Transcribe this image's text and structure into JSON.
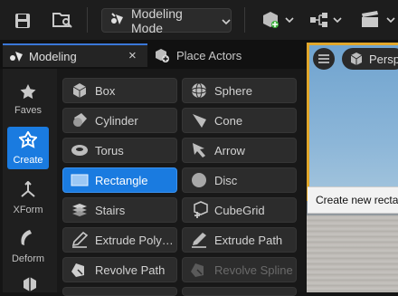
{
  "toolbar": {
    "mode_label": "Modeling Mode",
    "icons": [
      "save-icon",
      "content-browser-icon",
      "mode-icon",
      "add-actor-icon",
      "blueprint-icon",
      "cinematics-icon"
    ]
  },
  "tabs": [
    {
      "label": "Modeling",
      "active": true,
      "close": "×"
    },
    {
      "label": "Place Actors",
      "active": false
    }
  ],
  "rail": [
    {
      "label": "Faves",
      "icon": "star-icon",
      "active": false
    },
    {
      "label": "Create",
      "icon": "create-icon",
      "active": true
    },
    {
      "label": "XForm",
      "icon": "xform-icon",
      "active": false
    },
    {
      "label": "Deform",
      "icon": "deform-icon",
      "active": false
    }
  ],
  "tools": [
    {
      "label": "Box",
      "icon": "box-icon"
    },
    {
      "label": "Sphere",
      "icon": "sphere-icon"
    },
    {
      "label": "Cylinder",
      "icon": "cylinder-icon"
    },
    {
      "label": "Cone",
      "icon": "cone-icon"
    },
    {
      "label": "Torus",
      "icon": "torus-icon"
    },
    {
      "label": "Arrow",
      "icon": "arrow-icon"
    },
    {
      "label": "Rectangle",
      "icon": "rectangle-icon",
      "selected": true
    },
    {
      "label": "Disc",
      "icon": "disc-icon"
    },
    {
      "label": "Stairs",
      "icon": "stairs-icon"
    },
    {
      "label": "CubeGrid",
      "icon": "cubegrid-icon"
    },
    {
      "label": "Extrude Poly…",
      "icon": "extrude-poly-icon"
    },
    {
      "label": "Extrude Path",
      "icon": "extrude-path-icon"
    },
    {
      "label": "Revolve Path",
      "icon": "revolve-path-icon"
    },
    {
      "label": "Revolve Spline",
      "icon": "revolve-spline-icon",
      "disabled": true
    }
  ],
  "viewport": {
    "perspective_label": "Perspe",
    "tooltip": "Create new recta"
  }
}
